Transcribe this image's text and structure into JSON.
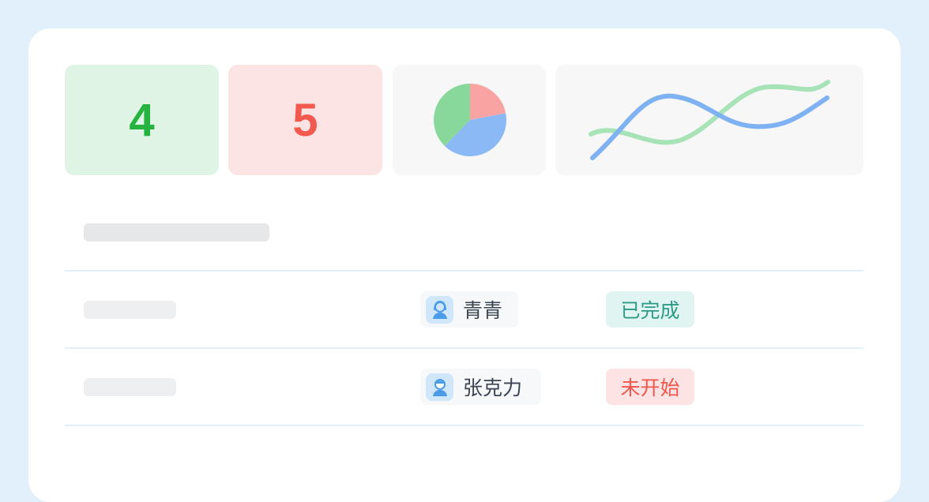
{
  "stats": {
    "completed_count": "4",
    "not_started_count": "5",
    "completed_color": "#26b33f",
    "not_started_color": "#f25a4f"
  },
  "charts": {
    "pie_slice_colors": [
      "#f9a3a3",
      "#8ab9f6",
      "#88d89b"
    ],
    "line_colors": [
      "#a8e3b8",
      "#7fb2f2"
    ]
  },
  "rows": [
    {
      "assignee": "青青",
      "avatar_icon": "female-user-icon",
      "status": "已完成",
      "status_color": "#2c9a86"
    },
    {
      "assignee": "张克力",
      "avatar_icon": "male-user-icon",
      "status": "未开始",
      "status_color": "#f0564b"
    }
  ]
}
